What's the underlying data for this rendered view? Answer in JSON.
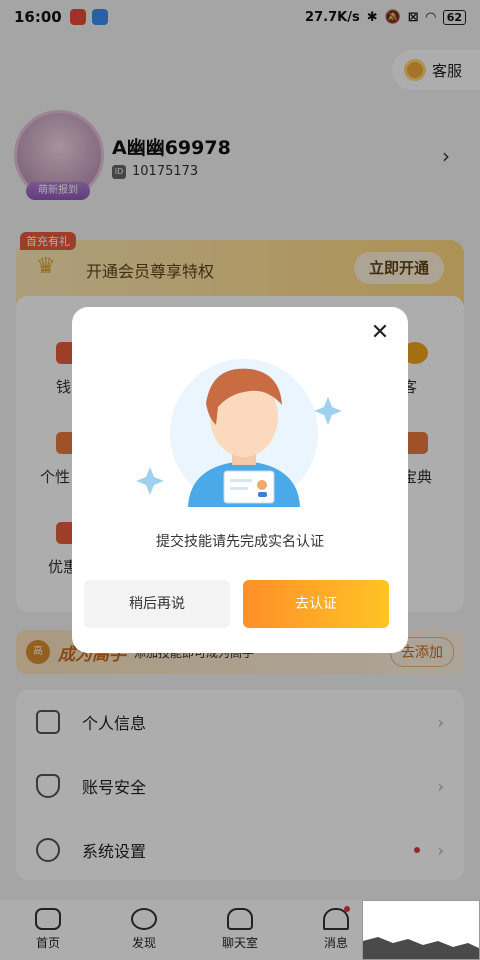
{
  "status_bar": {
    "time": "16:00",
    "network_speed": "27.7K/s",
    "battery": "62"
  },
  "service": {
    "label": "客服"
  },
  "profile": {
    "username": "A幽幽69978",
    "user_id": "10175173",
    "id_icon": "ID",
    "avatar_badge": "萌新报到"
  },
  "vip": {
    "tag": "首充有礼",
    "text": "开通会员尊享特权",
    "button": "立即开通"
  },
  "grid": {
    "items": [
      {
        "label": "钱"
      },
      {
        "label": "客"
      },
      {
        "label": "个性"
      },
      {
        "label": "宝典"
      },
      {
        "label": "优惠"
      }
    ]
  },
  "master": {
    "badge": "高",
    "title": "成为高手",
    "desc": "添加技能即可成为高手",
    "button": "去添加"
  },
  "menu": {
    "items": [
      {
        "label": "个人信息"
      },
      {
        "label": "账号安全"
      },
      {
        "label": "系统设置"
      }
    ]
  },
  "tabs": [
    {
      "label": "首页"
    },
    {
      "label": "发现"
    },
    {
      "label": "聊天室"
    },
    {
      "label": "消息"
    }
  ],
  "modal": {
    "message": "提交技能请先完成实名认证",
    "later_button": "稍后再说",
    "verify_button": "去认证"
  },
  "colors": {
    "accent_orange": "#ff8f2a",
    "accent_yellow": "#ffc424",
    "badge_red": "#e03b3b"
  }
}
